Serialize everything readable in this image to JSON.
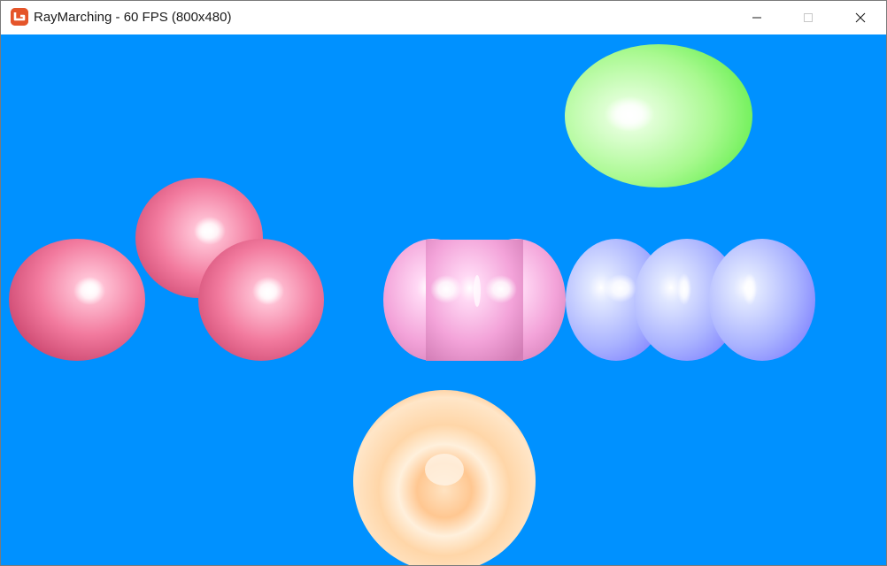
{
  "window": {
    "title": "RayMarching - 60 FPS (800x480)",
    "app_icon": "monogame-icon",
    "controls": {
      "minimize": "minimize-icon",
      "maximize": "maximize-icon",
      "close": "close-icon"
    }
  },
  "scene": {
    "background_color": "#0091ff",
    "objects": [
      {
        "name": "pink-sphere-left",
        "color": "#e8567f"
      },
      {
        "name": "pink-sphere-pair",
        "color": "#ee6a92"
      },
      {
        "name": "magenta-blob-double",
        "color": "#f59ad6"
      },
      {
        "name": "blue-blob-triple",
        "color": "#8a8cff"
      },
      {
        "name": "green-ellipsoid",
        "color": "#7ff56a"
      },
      {
        "name": "peach-torus-sphere",
        "color": "#ffc889"
      }
    ]
  }
}
